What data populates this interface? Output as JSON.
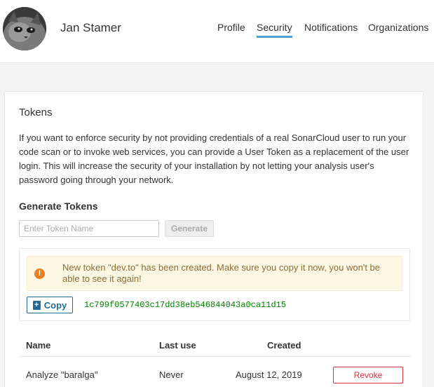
{
  "header": {
    "user_name": "Jan Stamer",
    "nav": [
      {
        "label": "Profile"
      },
      {
        "label": "Security",
        "active": true
      },
      {
        "label": "Notifications"
      },
      {
        "label": "Organizations"
      }
    ]
  },
  "tokens": {
    "title": "Tokens",
    "description": "If you want to enforce security by not providing credentials of a real SonarCloud user to run your code scan or to invoke web services, you can provide a User Token as a replacement of the user login. This will increase the security of your installation by not letting your analysis user's password going through your network.",
    "generate_heading": "Generate Tokens",
    "input_placeholder": "Enter Token Name",
    "generate_label": "Generate",
    "alert_text": "New token \"dev.to\" has been created. Make sure you copy it now, you won't be able to see it again!",
    "copy_label": "Copy",
    "token_value": "1c799f0577403c17dd38eb546844043a0ca11d15",
    "table": {
      "columns": [
        "Name",
        "Last use",
        "Created"
      ],
      "rows": [
        {
          "name": "Analyze \"baralga\"",
          "last_use": "Never",
          "created": "August 12, 2019",
          "action": "Revoke"
        }
      ]
    }
  },
  "colors": {
    "accent": "#4b9fd5",
    "warning_bg": "#fcf8e3",
    "warning_text": "#8a6d3b",
    "token_green": "#008200",
    "revoke_red": "#d4333f",
    "copy_blue": "#236a97"
  }
}
